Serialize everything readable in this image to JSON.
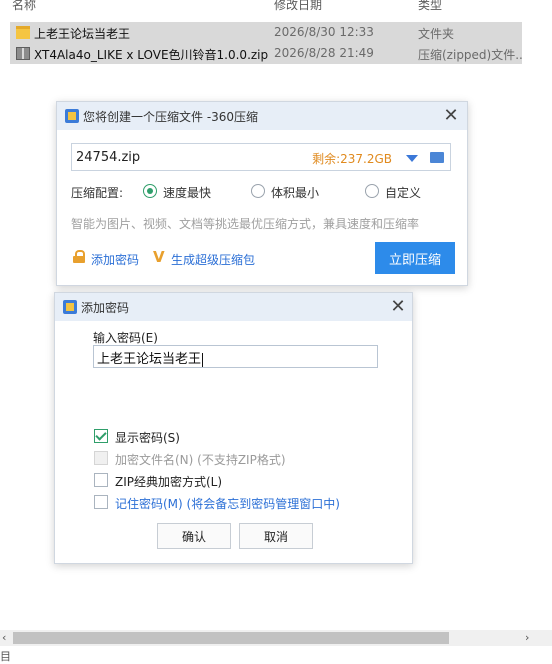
{
  "explorer": {
    "columns": {
      "name": "名称",
      "date": "修改日期",
      "type": "类型"
    },
    "rows": [
      {
        "name": "上老王论坛当老王",
        "date": "2026/8/30 12:33",
        "type": "文件夹",
        "icon": "folder-icon"
      },
      {
        "name": "XT4Ala4o_LIKE x LOVE色川铃音1.0.0.zip",
        "date": "2026/8/28 21:49",
        "type": "压缩(zipped)文件...",
        "icon": "zip-icon"
      }
    ],
    "bottom_glyph": "目"
  },
  "compress_dialog": {
    "title": "您将创建一个压缩文件 -360压缩",
    "close": "✕",
    "filename": "24754.zip",
    "remaining": "剩余:237.2GB",
    "config_label": "压缩配置:",
    "options": [
      {
        "label": "速度最快",
        "selected": true
      },
      {
        "label": "体积最小",
        "selected": false
      },
      {
        "label": "自定义",
        "selected": false
      }
    ],
    "hint": "智能为图片、视频、文档等挑选最优压缩方式，兼具速度和压缩率",
    "add_password": "添加密码",
    "super_pack": "生成超级压缩包",
    "super_pack_icon_glyph": "V",
    "compress_button": "立即压缩"
  },
  "password_dialog": {
    "title": "添加密码",
    "close": "✕",
    "input_label": "输入密码(E)",
    "input_value": "上老王论坛当老王",
    "checkboxes": [
      {
        "label": "显示密码(S)",
        "checked": true,
        "disabled": false
      },
      {
        "label": "加密文件名(N) (不支持ZIP格式)",
        "checked": false,
        "disabled": true
      },
      {
        "label": "ZIP经典加密方式(L)",
        "checked": false,
        "disabled": false
      },
      {
        "label": "记住密码(M) (将会备忘到密码管理窗口中)",
        "checked": false,
        "disabled": false
      }
    ],
    "ok_button": "确认",
    "cancel_button": "取消"
  },
  "scrollbar": {
    "left_arrow": "‹",
    "right_arrow": "›"
  },
  "colors": {
    "accent": "#2d8bea",
    "green": "#2f9e6a",
    "orange": "#e08a1e",
    "link": "#2b6fd6"
  }
}
